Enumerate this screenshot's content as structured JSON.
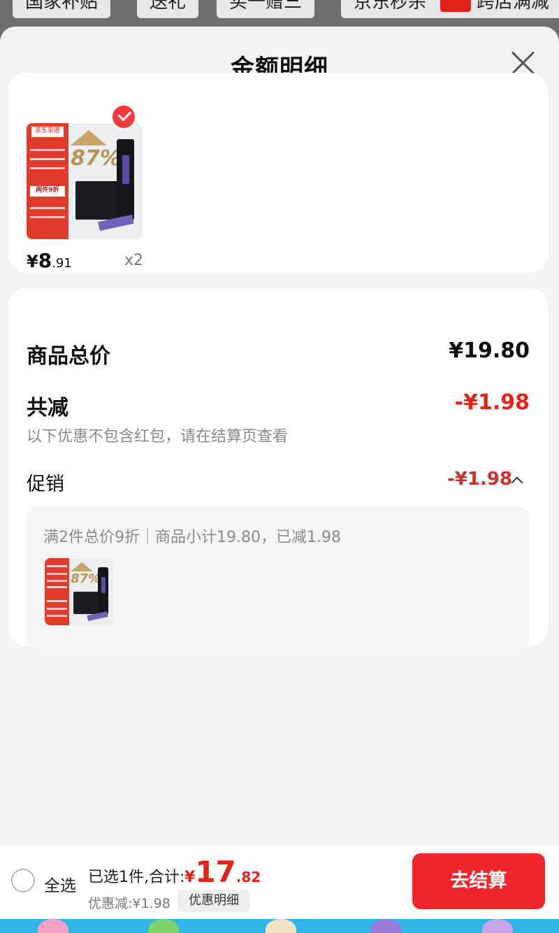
{
  "background_tabs": [
    "国家补贴",
    "送礼",
    "买一赠三",
    "京东秒杀",
    "跨店满减"
  ],
  "sheet": {
    "title": "金额明细"
  },
  "item": {
    "brand": "京东京造",
    "badge": "两件9折",
    "pct": "87%",
    "price_symbol": "¥",
    "price_int": "8",
    "price_dec": ".91",
    "quantity": "x2"
  },
  "summary": {
    "total_label": "商品总价",
    "total_value": "¥19.80",
    "reduce_label": "共减",
    "reduce_value": "-¥1.98",
    "note": "以下优惠不包含红包，请在结算页查看",
    "promo_label": "促销",
    "promo_value": "-¥1.98",
    "promo_desc": "满2件总价9折｜商品小计19.80，已减1.98"
  },
  "bottom": {
    "select_all": "全选",
    "selected_info": "已选1件,合计:",
    "total_symbol": "¥",
    "total_int": "17",
    "total_dec": ".82",
    "discount": "优惠减:¥1.98",
    "detail_button": "优惠明细",
    "checkout_button": "去结算"
  },
  "colors": {
    "accent_red": "#e2231a",
    "checkout_red": "#f0262d",
    "card_bg": "#ffffff",
    "sheet_bg": "#f3f3f3"
  },
  "icons": {
    "close": "close-icon",
    "selected": "check-circle-icon",
    "expand": "chevron-up-icon",
    "radio": "radio-unchecked-icon"
  }
}
